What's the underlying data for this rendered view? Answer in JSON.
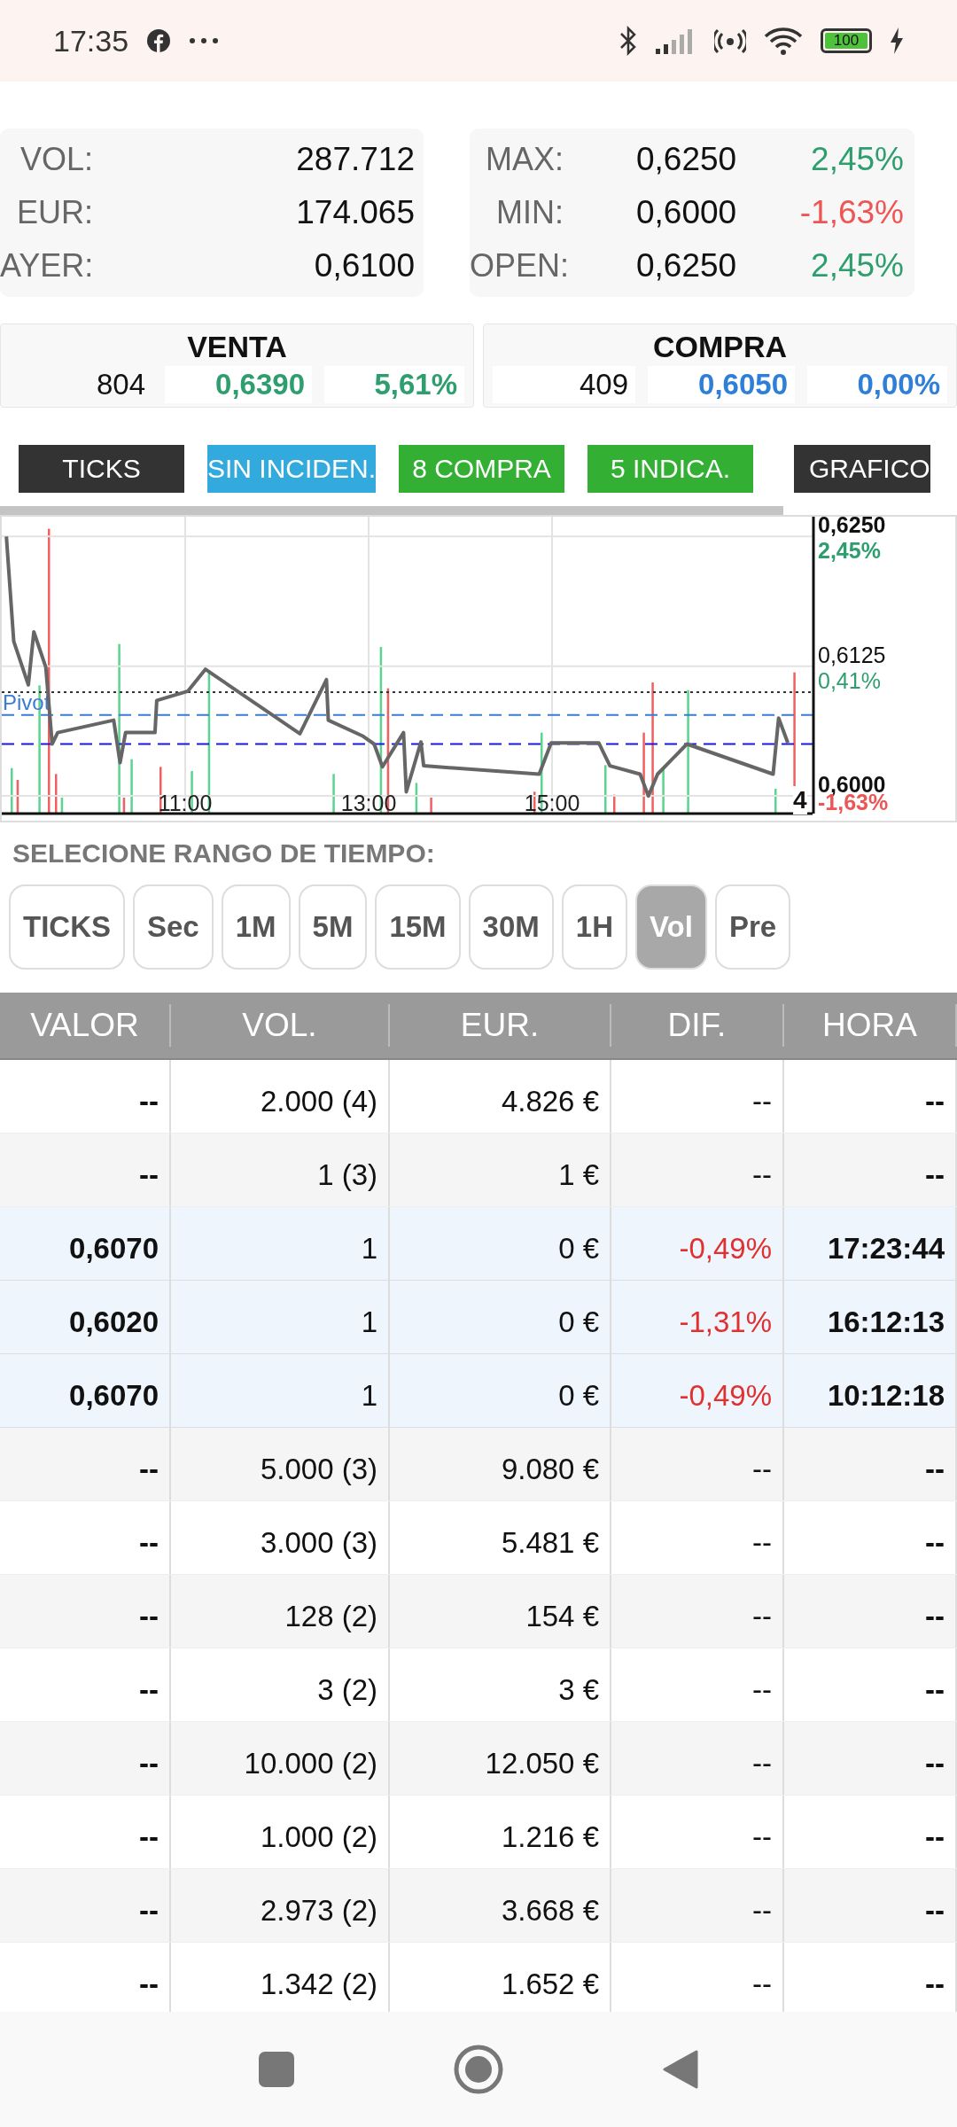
{
  "status_bar": {
    "time": "17:35",
    "battery": "100"
  },
  "stats_left": [
    {
      "label": "VOL:",
      "value": "287.712"
    },
    {
      "label": "EUR:",
      "value": "174.065"
    },
    {
      "label": "AYER:",
      "value": "0,6100"
    }
  ],
  "stats_right": [
    {
      "label": "MAX:",
      "value": "0,6250",
      "change": "2,45%",
      "color": "#2e9e6e"
    },
    {
      "label": "MIN:",
      "value": "0,6000",
      "change": "-1,63%",
      "color": "#ee5555"
    },
    {
      "label": "OPEN:",
      "value": "0,6250",
      "change": "2,45%",
      "color": "#2e9e6e"
    }
  ],
  "venta": {
    "title": "VENTA",
    "qty": "804",
    "price": "0,6390",
    "change": "5,61%"
  },
  "compra": {
    "title": "COMPRA",
    "qty": "409",
    "price": "0,6050",
    "change": "0,00%"
  },
  "tabs": [
    {
      "label": "TICKS",
      "color": "#333333"
    },
    {
      "label": "SIN INCIDEN.",
      "color": "#33aadd"
    },
    {
      "label": "8 COMPRA",
      "color": "#33b033"
    },
    {
      "label": "5 INDICA.",
      "color": "#33b033"
    },
    {
      "label": "GRAFICO",
      "color": "#333333"
    }
  ],
  "chart": {
    "chart_data": {
      "type": "line",
      "x": [
        9.05,
        9.13,
        9.29,
        9.35,
        9.48,
        9.55,
        9.61,
        10.22,
        10.29,
        10.35,
        10.67,
        10.69,
        11.03,
        11.22,
        12.25,
        12.54,
        12.56,
        12.93,
        13.06,
        13.15,
        13.38,
        13.41,
        13.57,
        13.6,
        14.86,
        14.99,
        15.51,
        15.63,
        15.96,
        16.05,
        16.15,
        16.47,
        17.41,
        17.47,
        17.57
      ],
      "series": [
        {
          "color": "#666666",
          "values": [
            0.625,
            0.6149,
            0.6107,
            0.6158,
            0.6124,
            0.605,
            0.6061,
            0.6073,
            0.6032,
            0.6061,
            0.6061,
            0.6092,
            0.6101,
            0.6122,
            0.606,
            0.6112,
            0.6073,
            0.6058,
            0.605,
            0.6028,
            0.6061,
            0.6004,
            0.6052,
            0.6029,
            0.6021,
            0.6051,
            0.6051,
            0.6029,
            0.6021,
            0.6,
            0.6021,
            0.605,
            0.6021,
            0.6075,
            0.6051
          ]
        }
      ],
      "xlim": [
        9,
        17.84
      ],
      "ylim": [
        0.5983,
        0.6269
      ],
      "xticks": [
        {
          "value": 11,
          "label": "11:00"
        },
        {
          "value": 13,
          "label": "13:00"
        },
        {
          "value": 15,
          "label": "15:00"
        }
      ],
      "yticks": [
        {
          "value": 0.625,
          "label": "0,6250"
        },
        {
          "value": 0.6125,
          "label": "0,6125"
        },
        {
          "value": 0.6,
          "label": "0,6000"
        }
      ],
      "grid": true,
      "ref_lines": [
        {
          "axis": "y",
          "value": 0.61,
          "color": "#333333"
        },
        {
          "axis": "y",
          "value": 0.6078,
          "color": "#3a7bd5",
          "label": "Pivot"
        },
        {
          "axis": "y",
          "value": 0.605,
          "color": "#1a1ae0"
        }
      ]
    },
    "change_labels": [
      {
        "text": "2,45%",
        "color": "#2e9e6e"
      },
      {
        "text": "0,41%",
        "color": "#2e9e6e"
      },
      {
        "text": "-1,63%",
        "color": "#ee5555"
      }
    ],
    "corner": "4"
  },
  "range": {
    "title": "SELECIONE RANGO DE TIEMPO:",
    "options": [
      {
        "label": "TICKS",
        "selected": false
      },
      {
        "label": "Sec",
        "selected": false
      },
      {
        "label": "1M",
        "selected": false
      },
      {
        "label": "5M",
        "selected": false
      },
      {
        "label": "15M",
        "selected": false
      },
      {
        "label": "30M",
        "selected": false
      },
      {
        "label": "1H",
        "selected": false
      },
      {
        "label": "Vol",
        "selected": true
      },
      {
        "label": "Pre",
        "selected": false
      }
    ]
  },
  "table": {
    "columns": [
      "VALOR",
      "VOL.",
      "EUR.",
      "DIF.",
      "HORA"
    ],
    "rows": [
      {
        "kind": "summary",
        "cells": [
          "--",
          "2.000 (4)",
          "4.826 €",
          "--",
          "--"
        ]
      },
      {
        "kind": "summary",
        "cells": [
          "--",
          "1 (3)",
          "1 €",
          "--",
          "--"
        ]
      },
      {
        "kind": "trade",
        "cells": [
          "0,6070",
          "1",
          "0 €",
          "-0,49%",
          "17:23:44"
        ]
      },
      {
        "kind": "trade",
        "cells": [
          "0,6020",
          "1",
          "0 €",
          "-1,31%",
          "16:12:13"
        ]
      },
      {
        "kind": "trade",
        "cells": [
          "0,6070",
          "1",
          "0 €",
          "-0,49%",
          "10:12:18"
        ]
      },
      {
        "kind": "summary",
        "cells": [
          "--",
          "5.000 (3)",
          "9.080 €",
          "--",
          "--"
        ]
      },
      {
        "kind": "summary",
        "cells": [
          "--",
          "3.000 (3)",
          "5.481 €",
          "--",
          "--"
        ]
      },
      {
        "kind": "summary",
        "cells": [
          "--",
          "128 (2)",
          "154 €",
          "--",
          "--"
        ]
      },
      {
        "kind": "summary",
        "cells": [
          "--",
          "3 (2)",
          "3 €",
          "--",
          "--"
        ]
      },
      {
        "kind": "summary",
        "cells": [
          "--",
          "10.000 (2)",
          "12.050 €",
          "--",
          "--"
        ]
      },
      {
        "kind": "summary",
        "cells": [
          "--",
          "1.000 (2)",
          "1.216 €",
          "--",
          "--"
        ]
      },
      {
        "kind": "summary",
        "cells": [
          "--",
          "2.973 (2)",
          "3.668 €",
          "--",
          "--"
        ]
      },
      {
        "kind": "summary",
        "cells": [
          "--",
          "1.342 (2)",
          "1.652 €",
          "--",
          "--"
        ]
      }
    ]
  }
}
